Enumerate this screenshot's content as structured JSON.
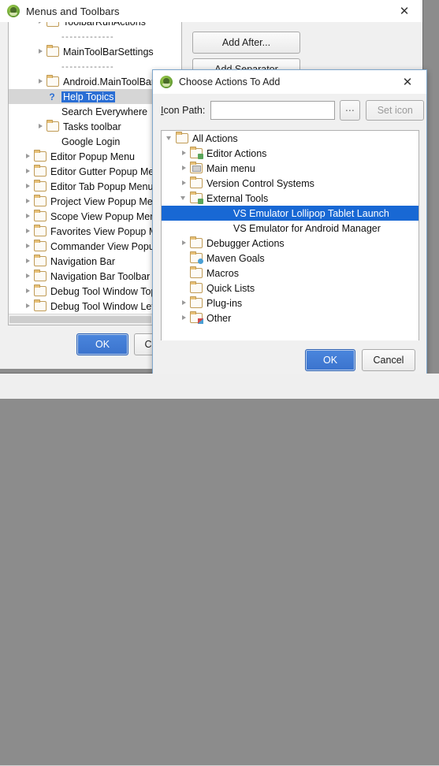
{
  "outer_window": {
    "title": "Menus and Toolbars",
    "icon": "idea-app-icon",
    "close_label": "✕",
    "buttons": {
      "add_after": "Add After...",
      "add_separator": "Add Separator",
      "ok": "OK",
      "cancel": "Cancel"
    },
    "tree": [
      {
        "indent": 2,
        "arrow": "right",
        "icon": "folder",
        "label": "ToolbarRunActions",
        "clipped": true
      },
      {
        "indent": 2,
        "arrow": "none",
        "icon": "none",
        "label": "-------------",
        "dashes": true
      },
      {
        "indent": 2,
        "arrow": "right",
        "icon": "folder",
        "label": "MainToolBarSettings"
      },
      {
        "indent": 2,
        "arrow": "none",
        "icon": "none",
        "label": "-------------",
        "dashes": true
      },
      {
        "indent": 2,
        "arrow": "right",
        "icon": "folder",
        "label": "Android.MainToolBar"
      },
      {
        "indent": 2,
        "arrow": "none",
        "icon": "question",
        "label": "Help Topics",
        "selected": true,
        "highlighted": true
      },
      {
        "indent": 2,
        "arrow": "none",
        "icon": "none",
        "label": "Search Everywhere"
      },
      {
        "indent": 2,
        "arrow": "right",
        "icon": "folder",
        "label": "Tasks toolbar"
      },
      {
        "indent": 2,
        "arrow": "none",
        "icon": "none",
        "label": "Google Login"
      },
      {
        "indent": 1,
        "arrow": "right",
        "icon": "folder",
        "label": "Editor Popup Menu"
      },
      {
        "indent": 1,
        "arrow": "right",
        "icon": "folder",
        "label": "Editor Gutter Popup Menu"
      },
      {
        "indent": 1,
        "arrow": "right",
        "icon": "folder",
        "label": "Editor Tab Popup Menu"
      },
      {
        "indent": 1,
        "arrow": "right",
        "icon": "folder",
        "label": "Project View Popup Menu"
      },
      {
        "indent": 1,
        "arrow": "right",
        "icon": "folder",
        "label": "Scope View Popup Menu"
      },
      {
        "indent": 1,
        "arrow": "right",
        "icon": "folder",
        "label": "Favorites View Popup Menu"
      },
      {
        "indent": 1,
        "arrow": "right",
        "icon": "folder",
        "label": "Commander View Popup Menu"
      },
      {
        "indent": 1,
        "arrow": "right",
        "icon": "folder",
        "label": "Navigation Bar"
      },
      {
        "indent": 1,
        "arrow": "right",
        "icon": "folder",
        "label": "Navigation Bar Toolbar"
      },
      {
        "indent": 1,
        "arrow": "right",
        "icon": "folder",
        "label": "Debug Tool Window Top Toolbar"
      },
      {
        "indent": 1,
        "arrow": "right",
        "icon": "folder",
        "label": "Debug Tool Window Left Toolbar"
      }
    ]
  },
  "inner_dialog": {
    "title": "Choose Actions To Add",
    "icon": "idea-app-icon",
    "close_label": "✕",
    "icon_path": {
      "label_prefix": "I",
      "label_rest": "con Path:",
      "value": "",
      "placeholder": "",
      "browse_label": "⋯",
      "set_icon_label": "Set icon"
    },
    "tree": [
      {
        "indent": 0,
        "arrow": "down",
        "icon": "folder",
        "label": "All Actions"
      },
      {
        "indent": 1,
        "arrow": "right",
        "icon": "folder-green",
        "label": "Editor Actions"
      },
      {
        "indent": 1,
        "arrow": "right",
        "icon": "folder-grey",
        "label": "Main menu"
      },
      {
        "indent": 1,
        "arrow": "right",
        "icon": "folder",
        "label": "Version Control Systems"
      },
      {
        "indent": 1,
        "arrow": "down",
        "icon": "folder-green",
        "label": "External Tools"
      },
      {
        "indent": 3,
        "arrow": "none",
        "icon": "none",
        "label": "VS Emulator Lollipop Tablet Launch",
        "selected": true
      },
      {
        "indent": 3,
        "arrow": "none",
        "icon": "none",
        "label": "VS Emulator for Android Manager"
      },
      {
        "indent": 1,
        "arrow": "right",
        "icon": "folder",
        "label": "Debugger Actions"
      },
      {
        "indent": 1,
        "arrow": "none",
        "icon": "folder-blue",
        "label": "Maven Goals"
      },
      {
        "indent": 1,
        "arrow": "none",
        "icon": "folder",
        "label": "Macros"
      },
      {
        "indent": 1,
        "arrow": "none",
        "icon": "folder",
        "label": "Quick Lists"
      },
      {
        "indent": 1,
        "arrow": "right",
        "icon": "folder",
        "label": "Plug-ins"
      },
      {
        "indent": 1,
        "arrow": "right",
        "icon": "folder-multi",
        "label": "Other"
      }
    ],
    "buttons": {
      "ok": "OK",
      "cancel": "Cancel"
    }
  },
  "colors": {
    "selection_blue": "#1868d4",
    "primary_button": "#3b73cd",
    "desktop_grey": "#8c8c8c",
    "dialog_face": "#f0f0f0"
  }
}
